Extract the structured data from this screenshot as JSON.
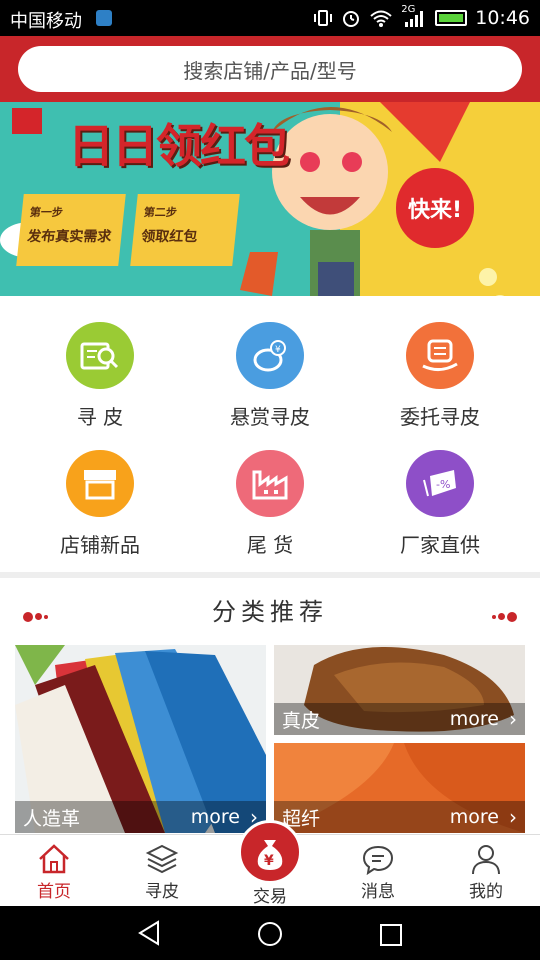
{
  "status_bar": {
    "carrier": "中国移动",
    "network_badge": "2G",
    "time": "10:46"
  },
  "search": {
    "placeholder": "搜索店铺/产品/型号"
  },
  "banner": {
    "title": "日日领红包",
    "step1_label": "第一步",
    "step1_text": "发布真实需求",
    "step2_label": "第二步",
    "step2_text": "领取红包",
    "callout": "快来!"
  },
  "grid": [
    {
      "label": "寻 皮",
      "icon": "search-document-icon",
      "color": "#9acb34"
    },
    {
      "label": "悬赏寻皮",
      "icon": "piggy-bank-icon",
      "color": "#4a9de0"
    },
    {
      "label": "委托寻皮",
      "icon": "hand-document-icon",
      "color": "#f2713a"
    },
    {
      "label": "店铺新品",
      "icon": "storefront-icon",
      "color": "#f8a21b"
    },
    {
      "label": "尾 货",
      "icon": "factory-icon",
      "color": "#ee6a79"
    },
    {
      "label": "厂家直供",
      "icon": "discount-tag-icon",
      "color": "#8e4fc8"
    }
  ],
  "section": {
    "title": "分类推荐"
  },
  "categories": [
    {
      "name": "人造革",
      "more": "more"
    },
    {
      "name": "真皮",
      "more": "more"
    },
    {
      "name": "超纤",
      "more": "more"
    }
  ],
  "bottom_nav": [
    {
      "label": "首页",
      "icon": "home-icon",
      "active": true
    },
    {
      "label": "寻皮",
      "icon": "layers-icon"
    },
    {
      "label": "交易",
      "icon": "money-bag-icon"
    },
    {
      "label": "消息",
      "icon": "chat-bubble-icon"
    },
    {
      "label": "我的",
      "icon": "user-icon"
    }
  ],
  "colors": {
    "brand_red": "#c8262a"
  }
}
